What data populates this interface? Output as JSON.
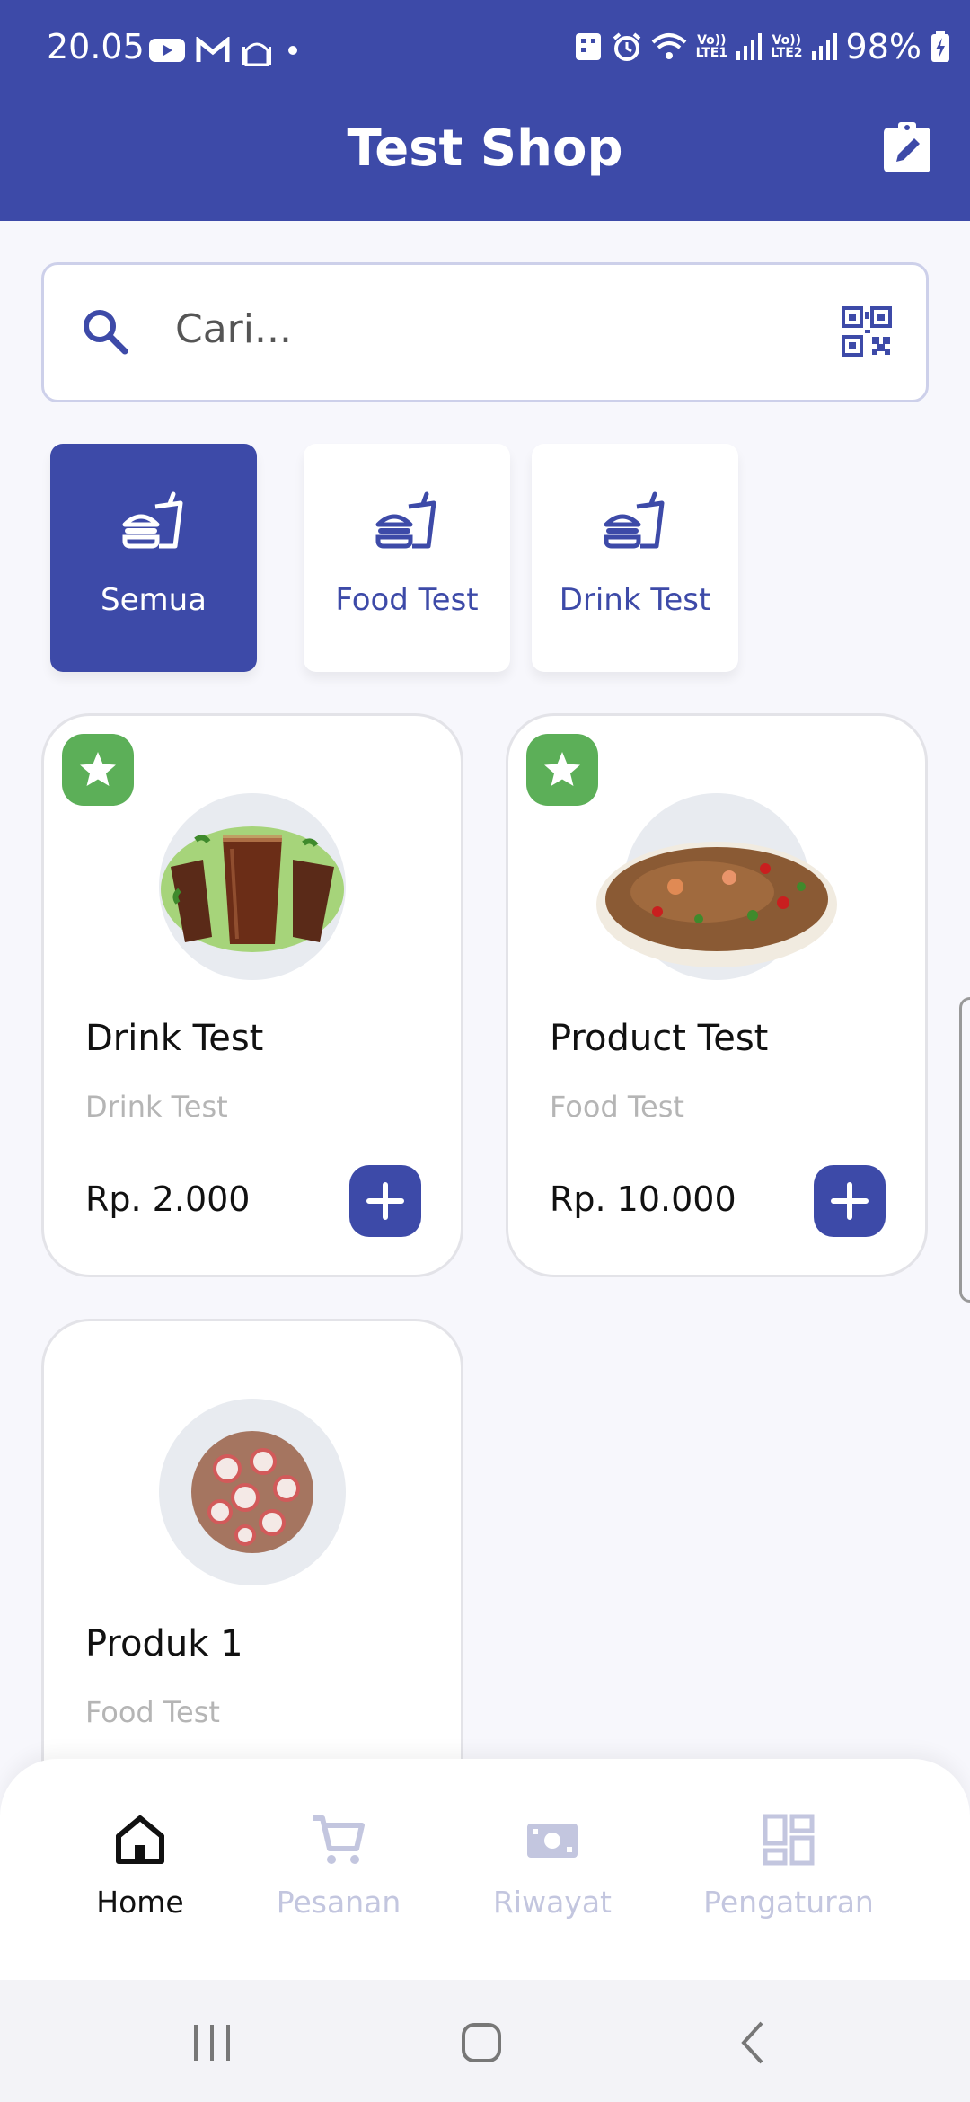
{
  "status_bar": {
    "time": "20.05",
    "battery": "98%",
    "lte1": "Vo))\nLTE1",
    "lte2": "Vo))\nLTE2"
  },
  "header": {
    "title": "Test Shop"
  },
  "search": {
    "placeholder": "Cari..."
  },
  "categories": [
    {
      "label": "Semua",
      "active": true
    },
    {
      "label": "Food Test",
      "active": false
    },
    {
      "label": "Drink Test",
      "active": false
    }
  ],
  "products": [
    {
      "name": "Drink Test",
      "category": "Drink Test",
      "price": "Rp. 2.000",
      "favorite": true,
      "image": "iced-tea-image"
    },
    {
      "name": "Product Test",
      "category": "Food Test",
      "price": "Rp. 10.000",
      "favorite": true,
      "image": "fried-rice-image"
    },
    {
      "name": "Produk 1",
      "category": "Food Test",
      "price": "",
      "favorite": false,
      "image": "fish-cake-image"
    }
  ],
  "bottom_nav": [
    {
      "label": "Home",
      "icon": "home-icon",
      "active": true
    },
    {
      "label": "Pesanan",
      "icon": "cart-icon",
      "active": false
    },
    {
      "label": "Riwayat",
      "icon": "money-icon",
      "active": false
    },
    {
      "label": "Pengaturan",
      "icon": "dashboard-icon",
      "active": false
    }
  ],
  "colors": {
    "primary": "#3d4aa8",
    "favorite": "#5caf58",
    "inactive": "#c3c6df",
    "background": "#f7f7fc"
  }
}
